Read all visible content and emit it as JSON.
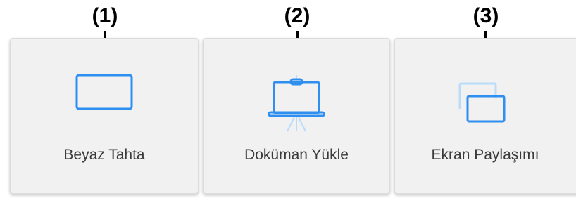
{
  "markers": [
    "(1)",
    "(2)",
    "(3)"
  ],
  "cards": [
    {
      "label": "Beyaz Tahta",
      "icon": "whiteboard-icon"
    },
    {
      "label": "Doküman Yükle",
      "icon": "presentation-board-icon"
    },
    {
      "label": "Ekran Paylaşımı",
      "icon": "screen-share-icon"
    }
  ],
  "colors": {
    "accent": "#2f8ff0",
    "accent_light": "#b9dcfb",
    "card_bg": "#f1f1f1",
    "label_text": "#3a3a3a"
  }
}
